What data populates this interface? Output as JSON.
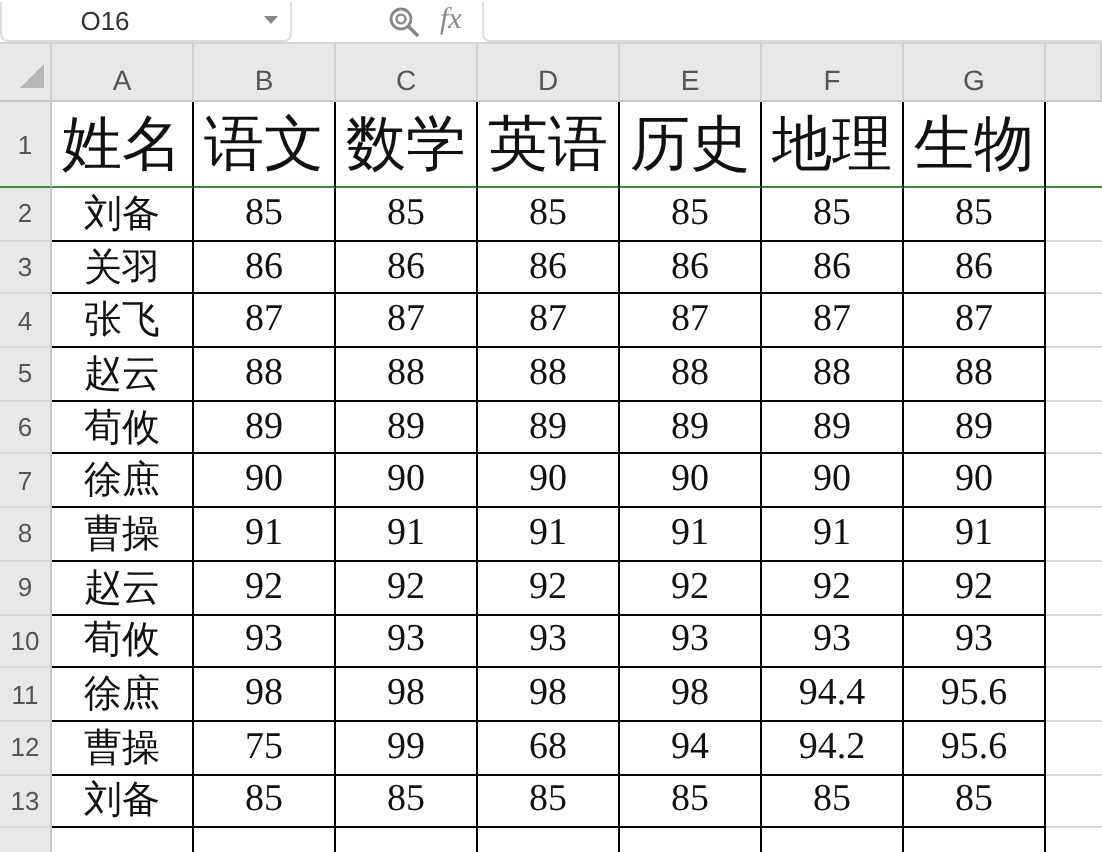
{
  "name_box": {
    "value": "O16"
  },
  "formula_bar": {
    "fx_label": "fx"
  },
  "columns": [
    "A",
    "B",
    "C",
    "D",
    "E",
    "F",
    "G"
  ],
  "rows": [
    {
      "number": "1",
      "cells": [
        "姓名",
        "语文",
        "数学",
        "英语",
        "历史",
        "地理",
        "生物"
      ]
    },
    {
      "number": "2",
      "cells": [
        "刘备",
        "85",
        "85",
        "85",
        "85",
        "85",
        "85"
      ]
    },
    {
      "number": "3",
      "cells": [
        "关羽",
        "86",
        "86",
        "86",
        "86",
        "86",
        "86"
      ]
    },
    {
      "number": "4",
      "cells": [
        "张飞",
        "87",
        "87",
        "87",
        "87",
        "87",
        "87"
      ]
    },
    {
      "number": "5",
      "cells": [
        "赵云",
        "88",
        "88",
        "88",
        "88",
        "88",
        "88"
      ]
    },
    {
      "number": "6",
      "cells": [
        "荀攸",
        "89",
        "89",
        "89",
        "89",
        "89",
        "89"
      ]
    },
    {
      "number": "7",
      "cells": [
        "徐庶",
        "90",
        "90",
        "90",
        "90",
        "90",
        "90"
      ]
    },
    {
      "number": "8",
      "cells": [
        "曹操",
        "91",
        "91",
        "91",
        "91",
        "91",
        "91"
      ]
    },
    {
      "number": "9",
      "cells": [
        "赵云",
        "92",
        "92",
        "92",
        "92",
        "92",
        "92"
      ]
    },
    {
      "number": "10",
      "cells": [
        "荀攸",
        "93",
        "93",
        "93",
        "93",
        "93",
        "93"
      ]
    },
    {
      "number": "11",
      "cells": [
        "徐庶",
        "98",
        "98",
        "98",
        "98",
        "94.4",
        "95.6"
      ]
    },
    {
      "number": "12",
      "cells": [
        "曹操",
        "75",
        "99",
        "68",
        "94",
        "94.2",
        "95.6"
      ]
    },
    {
      "number": "13",
      "cells": [
        "刘备",
        "85",
        "85",
        "85",
        "85",
        "85",
        "85"
      ]
    }
  ]
}
